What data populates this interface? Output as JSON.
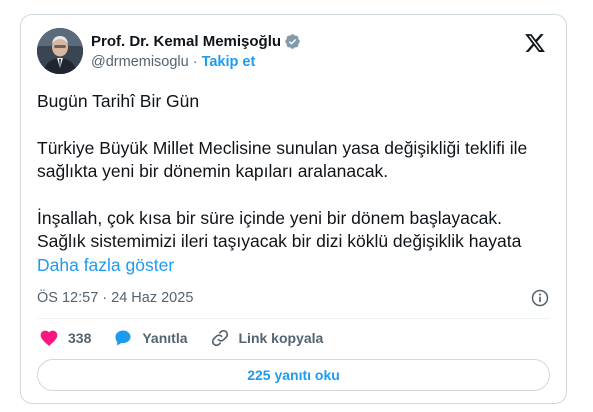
{
  "author": {
    "name": "Prof. Dr. Kemal Memişoğlu",
    "handle": "@drmemisoglu",
    "separator": "·",
    "follow_label": "Takip et"
  },
  "tweet": {
    "paragraphs": [
      "Bugün Tarihî Bir Gün",
      "Türkiye Büyük Millet Meclisine sunulan yasa değişikliği teklifi ile sağlıkta yeni bir dönemin kapıları aralanacak.",
      "İnşallah, çok kısa bir süre içinde yeni bir dönem başlayacak. Sağlık sistemimizi ileri taşıyacak bir dizi köklü değişiklik hayata"
    ],
    "show_more_label": "Daha fazla göster",
    "timestamp": "ÖS 12:57 · 24 Haz 2025"
  },
  "actions": {
    "like_count": "338",
    "reply_label": "Yanıtla",
    "copy_link_label": "Link kopyala"
  },
  "replies_button_label": "225 yanıtı oku",
  "colors": {
    "accent": "#1d9bf0",
    "like": "#f91880",
    "muted": "#536471",
    "text": "#0f1419",
    "border": "#cfd9de"
  },
  "icons": {
    "verified": "verified-badge-icon",
    "x_logo": "x-logo-icon",
    "info": "info-icon",
    "like": "heart-icon",
    "reply": "speech-bubble-icon",
    "link": "link-icon"
  }
}
